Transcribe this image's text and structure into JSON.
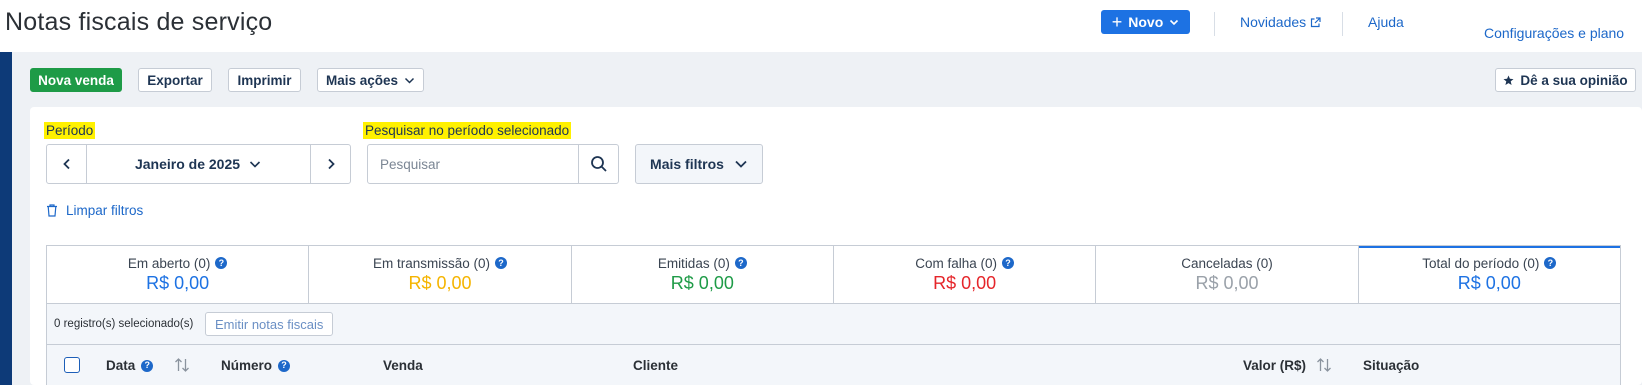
{
  "header": {
    "title": "Notas fiscais de serviço",
    "new_button": "Novo",
    "links": {
      "novidades": "Novidades",
      "ajuda": "Ajuda",
      "config": "Configurações e plano"
    }
  },
  "toolbar": {
    "nova_venda": "Nova venda",
    "exportar": "Exportar",
    "imprimir": "Imprimir",
    "mais_acoes": "Mais ações",
    "opiniao": "Dê a sua opinião"
  },
  "filters": {
    "period_label": "Período",
    "period_value": "Janeiro de 2025",
    "search_label": "Pesquisar no período selecionado",
    "search_placeholder": "Pesquisar",
    "search_value": "",
    "more_filters": "Mais filtros",
    "clear_filters": "Limpar filtros"
  },
  "stats": [
    {
      "label": "Em aberto (0)",
      "value": "R$ 0,00",
      "color": "#1d72e3",
      "help": true,
      "active": false
    },
    {
      "label": "Em transmissão (0)",
      "value": "R$ 0,00",
      "color": "#f5b400",
      "help": true,
      "active": false
    },
    {
      "label": "Emitidas (0)",
      "value": "R$ 0,00",
      "color": "#1e9b47",
      "help": true,
      "active": false
    },
    {
      "label": "Com falha (0)",
      "value": "R$ 0,00",
      "color": "#e5252a",
      "help": true,
      "active": false
    },
    {
      "label": "Canceladas (0)",
      "value": "R$ 0,00",
      "color": "#9aa1a9",
      "help": false,
      "active": false
    },
    {
      "label": "Total do período (0)",
      "value": "R$ 0,00",
      "color": "#1d72e3",
      "help": true,
      "active": true
    }
  ],
  "selection": {
    "count_text": "0 registro(s) selecionado(s)",
    "emit_button": "Emitir notas fiscais"
  },
  "table": {
    "columns": {
      "data": "Data",
      "numero": "Número",
      "venda": "Venda",
      "cliente": "Cliente",
      "valor": "Valor (R$)",
      "situacao": "Situação"
    }
  },
  "colors": {
    "primary": "#1d72e3",
    "success": "#1e9b47",
    "sidebar": "#0d3a78",
    "highlight": "#fff100"
  },
  "icons": {
    "help": "?"
  }
}
